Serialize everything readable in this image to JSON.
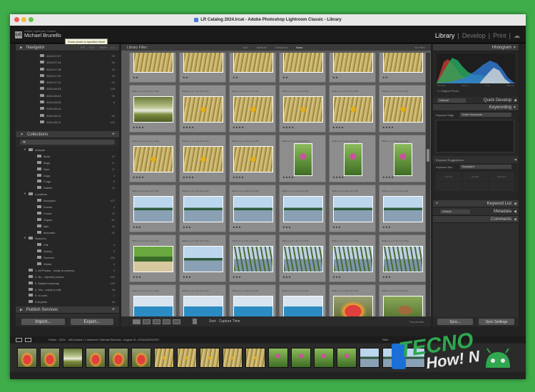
{
  "window": {
    "title": "LR Catalog 2024.lrcat - Adobe Photoshop Lightroom Classic - Library"
  },
  "identity": {
    "app_sub": "Adobe Lightroom Classic",
    "user": "Michael Brunello",
    "tooltip": "Zoom photo to specified level"
  },
  "modules": [
    "Library",
    "Develop",
    "Print"
  ],
  "left": {
    "navigator_title": "Navigator",
    "nav_modes": [
      "FIT",
      "FILL",
      "100%",
      "1:1"
    ],
    "folders": [
      {
        "name": "2024-07-07",
        "count": "39"
      },
      {
        "name": "2024-07-14",
        "count": "46"
      },
      {
        "name": "2024-07-18",
        "count": "18"
      },
      {
        "name": "2024-07-20",
        "count": "25"
      },
      {
        "name": "2024-07-21",
        "count": "54"
      },
      {
        "name": "2024-08-03",
        "count": "128"
      },
      {
        "name": "2024-08-03",
        "count": "35"
      },
      {
        "name": "2024-08-05",
        "count": "6"
      },
      {
        "name": "2024-08-10",
        "count": ""
      },
      {
        "name": "2024-08-11",
        "count": "80"
      },
      {
        "name": "2024-08-11",
        "count": "104"
      }
    ],
    "collections_title": "Collections",
    "collections": [
      {
        "type": "set",
        "name": "Animals",
        "count": "",
        "indent": 0
      },
      {
        "type": "col",
        "name": "Birds",
        "count": "47",
        "indent": 1
      },
      {
        "type": "col",
        "name": "Bugs",
        "count": "17",
        "indent": 1
      },
      {
        "type": "col",
        "name": "Deer",
        "count": "17",
        "indent": 1
      },
      {
        "type": "col",
        "name": "Dogs",
        "count": "2",
        "indent": 1
      },
      {
        "type": "col",
        "name": "Frogs",
        "count": "8",
        "indent": 1
      },
      {
        "type": "col",
        "name": "Rabbit",
        "count": "14",
        "indent": 1
      },
      {
        "type": "set",
        "name": "Locations",
        "count": "",
        "indent": 0
      },
      {
        "type": "col",
        "name": "Backyard",
        "count": "127",
        "indent": 1
      },
      {
        "type": "col",
        "name": "Events",
        "count": "4",
        "indent": 1
      },
      {
        "type": "col",
        "name": "Forest",
        "count": "24",
        "indent": 1
      },
      {
        "type": "col",
        "name": "Kripalu",
        "count": "87",
        "indent": 1
      },
      {
        "type": "col",
        "name": "lake",
        "count": "31",
        "indent": 1
      },
      {
        "type": "col",
        "name": "Mountain",
        "count": "92",
        "indent": 1
      },
      {
        "type": "set",
        "name": "Seasons",
        "count": "",
        "indent": 0
      },
      {
        "type": "col",
        "name": "Fall",
        "count": "0",
        "indent": 1
      },
      {
        "type": "col",
        "name": "Spring",
        "count": "3",
        "indent": 1
      },
      {
        "type": "col",
        "name": "Summer",
        "count": "236",
        "indent": 1
      },
      {
        "type": "col",
        "name": "Winter",
        "count": "0",
        "indent": 1
      },
      {
        "type": "col",
        "name": "1. All Photos - ready to process",
        "count": "3",
        "indent": 0
      },
      {
        "type": "col",
        "name": "2. No - rejected photos",
        "count": "442",
        "indent": 0
      },
      {
        "type": "col",
        "name": "3. Maybe/someday",
        "count": "149",
        "indent": 0
      },
      {
        "type": "col",
        "name": "4. Yes - ready to edit",
        "count": "36",
        "indent": 0
      },
      {
        "type": "col",
        "name": "5. In work",
        "count": "1",
        "indent": 0
      },
      {
        "type": "col",
        "name": "Complete",
        "count": "46",
        "indent": 0
      },
      {
        "type": "col",
        "name": "Flowers",
        "count": "3",
        "indent": 0
      }
    ],
    "publish_title": "Publish Services",
    "import_label": "Import...",
    "export_label": "Export..."
  },
  "center": {
    "filter_title": "Library Filter :",
    "filter_opts": [
      "Text",
      "Attribute",
      "Metadata",
      "None"
    ],
    "no_filter": "No Filter",
    "meta_line": "2008-xxx-at 1    f/11 1/a 0 P60",
    "sort_label": "Sort:",
    "sort_value": "Capture Time",
    "thumbs_label": "Thumbnails"
  },
  "right": {
    "histogram_title": "Histogram",
    "hist_info": [
      "ISO 100",
      "50 mm",
      "f / 11",
      "1/50 sec"
    ],
    "original_photo": "Original Photo",
    "qd_preset": "Default",
    "quick_develop": "Quick Develop",
    "keywording": "Keywording",
    "kw_tags_label": "Keyword Tags",
    "kw_tags_value": "Enter Keywords",
    "kw_suggestions": "Keyword Suggestions",
    "kw_set_label": "Keyword Set",
    "kw_set_value": "Backyard",
    "kw_set_items": [
      "summer",
      "animals",
      "backyard",
      "",
      "",
      ""
    ],
    "keyword_list": "Keyword List",
    "meta_preset": "Default",
    "metadata": "Metadata",
    "comments": "Comments",
    "sync_label": "Sync...",
    "sync_settings_label": "Sync Settings"
  },
  "filmstrip": {
    "folder": "Folder : 2024",
    "info": "450 photos / 1 selected / Michael Brunello - August 11, 2024/A2029CR2",
    "filter": "Filter :"
  },
  "watermark": {
    "line1": "TECNO",
    "line2": "How! N"
  }
}
